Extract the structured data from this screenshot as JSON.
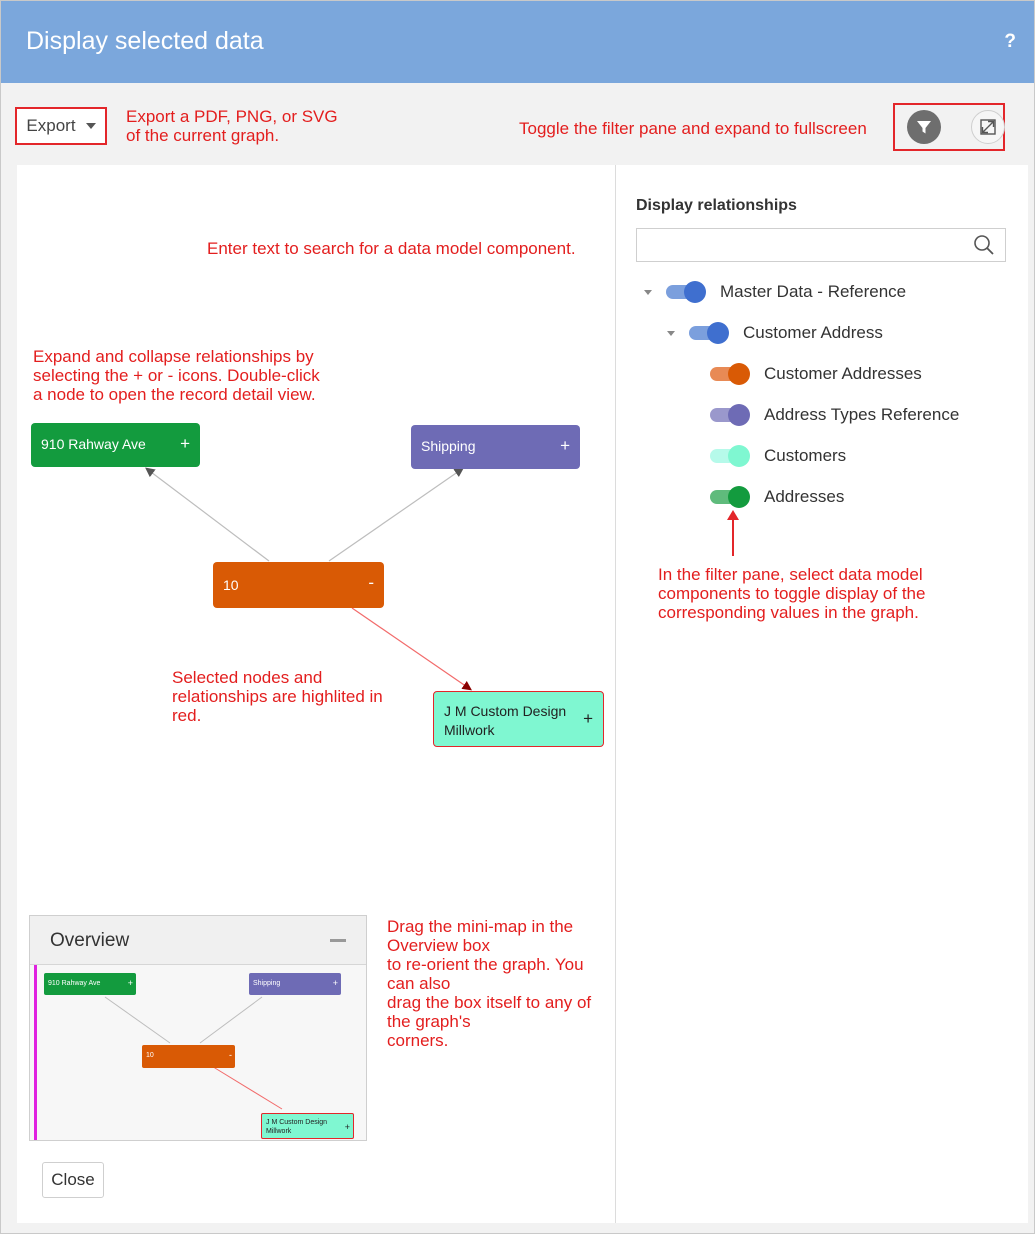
{
  "header": {
    "title": "Display selected data",
    "help": "?"
  },
  "toolbar": {
    "export_label": "Export",
    "export_note": [
      "Export a PDF, PNG, or SVG",
      "of the current graph."
    ],
    "toggle_note": "Toggle the filter pane and expand to fullscreen"
  },
  "icons": {
    "filter": "filter-icon",
    "expand": "expand-icon",
    "search": "search-icon"
  },
  "filter": {
    "title": "Display relationships",
    "search_placeholder": "",
    "items": [
      {
        "label": "Master Data - Reference",
        "color": "#3f6fcf",
        "track": "#7b9fdd"
      },
      {
        "label": "Customer Address",
        "color": "#3f6fcf",
        "track": "#7b9fdd"
      },
      {
        "label": "Customer Addresses",
        "color": "#d95a05",
        "track": "#e88a55"
      },
      {
        "label": "Address Types Reference",
        "color": "#6e6bb5",
        "track": "#9a98cc"
      },
      {
        "label": "Customers",
        "color": "#7ff7d1",
        "track": "#b6faea"
      },
      {
        "label": "Addresses",
        "color": "#139b3e",
        "track": "#5fbb7c"
      }
    ],
    "note": [
      "In the filter pane, select data model",
      "components to toggle display of the",
      "corresponding values in the graph."
    ]
  },
  "graph": {
    "search_note": "Enter text to search for a data model component.",
    "expand_note": [
      "Expand and collapse relationships by",
      "selecting the + or - icons. Double-click",
      "a node to open the record detail view."
    ],
    "selected_note": [
      "Selected nodes and",
      "relationships are highlited in",
      "red."
    ],
    "overview_note": [
      "Drag the mini-map in the Overview box",
      "to re-orient the graph. You can also",
      "drag the box itself to any of the graph's",
      "corners."
    ],
    "nodes": {
      "address": {
        "label": "910 Rahway Ave",
        "toggle": "+",
        "color": "#139b3e"
      },
      "shipping": {
        "label": "Shipping",
        "toggle": "+",
        "color": "#6e6bb5"
      },
      "center": {
        "label": "10",
        "toggle": "-",
        "color": "#d95a05"
      },
      "customer": {
        "label": "J M Custom Design Millwork",
        "label_line1": "J M Custom Design",
        "label_line2": "Millwork",
        "toggle": "+",
        "color": "#7ff7d1"
      }
    },
    "highlight_color": "#e3262a"
  },
  "overview": {
    "title": "Overview"
  },
  "footer": {
    "close_label": "Close"
  }
}
